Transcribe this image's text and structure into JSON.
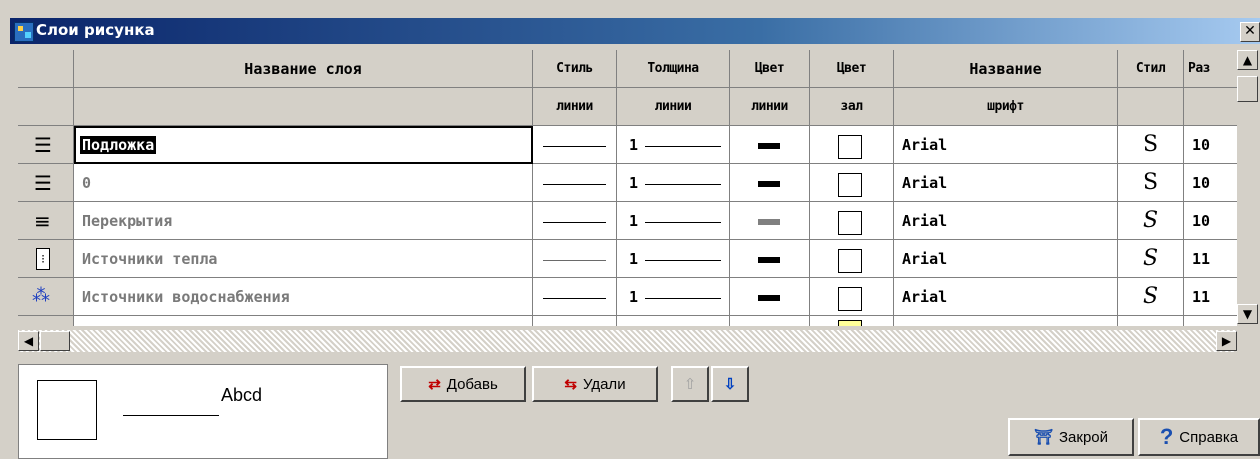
{
  "window": {
    "title": "Слои рисунка",
    "close_glyph": "✕"
  },
  "grid": {
    "headers": {
      "name": "Название слоя",
      "line_style_1": "Стиль",
      "line_style_2": "линии",
      "thickness_1": "Толщина",
      "thickness_2": "линии",
      "color_1": "Цвет",
      "color_2": "линии",
      "fill_color_1": "Цвет",
      "fill_color_2": "зал",
      "font_1": "Название",
      "font_2": "шрифт",
      "style": "Стил",
      "size": "Раз"
    },
    "rows": [
      {
        "icon": "layers-icon",
        "name": "Подложка",
        "thickness": "1",
        "font": "Arial",
        "style": "S",
        "style_italic": false,
        "size": "10",
        "color": "#000000",
        "selected": true
      },
      {
        "icon": "layers-icon",
        "name": "0",
        "thickness": "1",
        "font": "Arial",
        "style": "S",
        "style_italic": false,
        "size": "10",
        "color": "#000000",
        "selected": false
      },
      {
        "icon": "slab-icon",
        "name": "Перекрытия",
        "thickness": "1",
        "font": "Arial",
        "style": "S",
        "style_italic": true,
        "size": "10",
        "color": "#808080",
        "selected": false
      },
      {
        "icon": "heat-source-icon",
        "name": "Источники тепла",
        "thickness": "1",
        "font": "Arial",
        "style": "S",
        "style_italic": true,
        "size": "11",
        "color": "#000000",
        "selected": false
      },
      {
        "icon": "water-source-icon",
        "name": "Источники водоснабжения",
        "thickness": "1",
        "font": "Arial",
        "style": "S",
        "style_italic": true,
        "size": "11",
        "color": "#000000",
        "selected": false
      }
    ]
  },
  "preview": {
    "text": "Abcd"
  },
  "buttons": {
    "add": "Добавь",
    "add_key": "Д",
    "delete": "Удали",
    "delete_key": "У",
    "close": "Закрой",
    "close_key": "З",
    "help": "Справка",
    "help_key": "С"
  }
}
